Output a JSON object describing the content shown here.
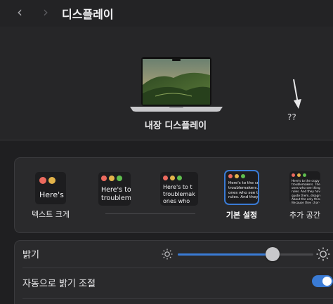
{
  "toolbar": {
    "back_icon": "chevron-left-icon",
    "forward_icon": "chevron-right-icon",
    "title": "디스플레이"
  },
  "hero": {
    "display_name": "내장 디스플레이",
    "unknown_label": "??"
  },
  "text_size": {
    "options": [
      {
        "label": "텍스트 크게",
        "sample": "Here's"
      },
      {
        "label": "",
        "sample": "Here's to\ntroublem"
      },
      {
        "label": "",
        "sample": "Here's to t\ntroublemak\nones who"
      },
      {
        "label": "기본 설정",
        "sample": "Here's to the cr\ntroublemakers.\nones who see t\nrules. And they"
      },
      {
        "label": "추가 공간",
        "sample": "Here's to the crazy one\ntroublemakers. The rou\nones who see things dif\nrules. And they have no\nquote them, disagree w\nAbout the only thing yo\nBecause they change th"
      }
    ],
    "selected_index": 3
  },
  "brightness": {
    "label": "밝기",
    "value": 0.7,
    "low_icon": "sun-small-icon",
    "high_icon": "sun-large-icon"
  },
  "auto_brightness": {
    "label": "자동으로 밝기 조절",
    "enabled": true
  },
  "colors": {
    "accent": "#3a7bd5",
    "dot_red": "#ec6a5e",
    "dot_yellow": "#e3b34a",
    "dot_green": "#5fbe4e"
  }
}
